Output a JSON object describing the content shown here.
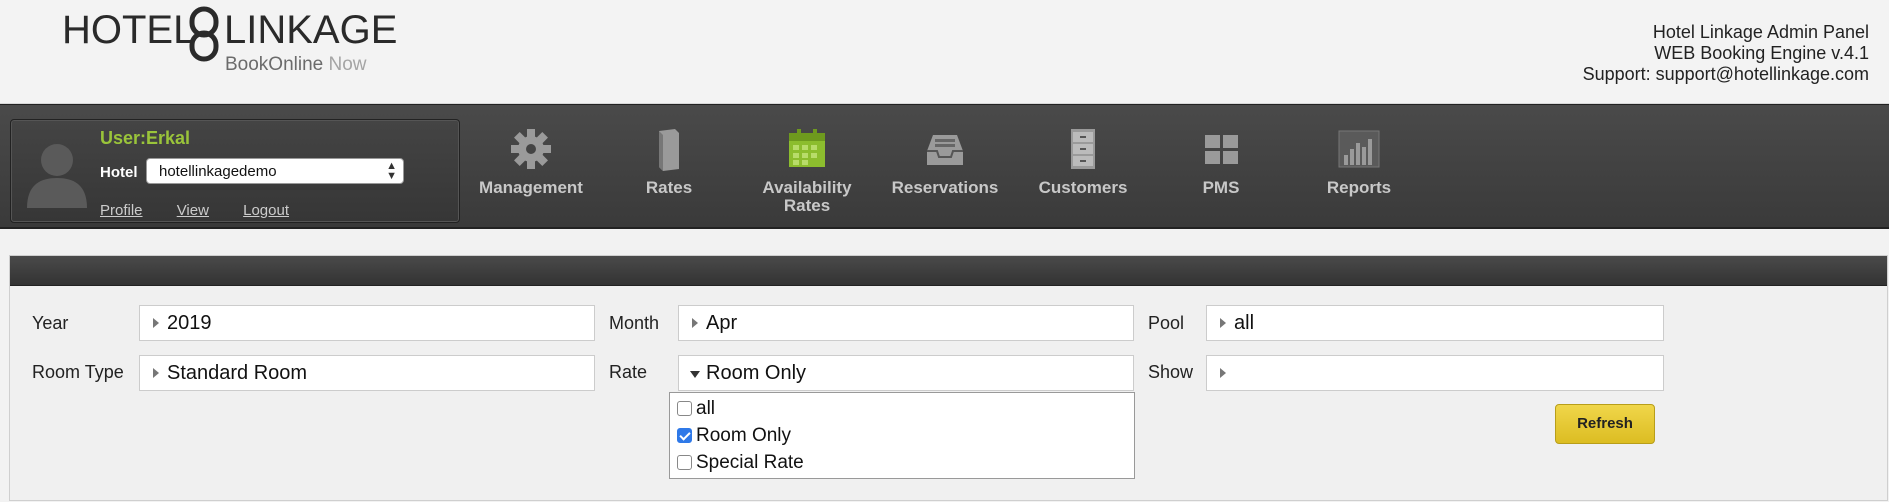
{
  "brand": {
    "word1": "HOTEL",
    "word2": "LINKAGE",
    "sub_main": "BookOnline",
    "sub_accent": "Now"
  },
  "header_info": {
    "line1": "Hotel Linkage Admin Panel",
    "line2": "WEB Booking Engine v.4.1",
    "line3": "Support: support@hotellinkage.com"
  },
  "user": {
    "name": "User:Erkal",
    "hotel_label": "Hotel",
    "hotel_value": "hotellinkagedemo",
    "links": [
      "Profile",
      "View",
      "Logout"
    ]
  },
  "nav": [
    {
      "label": "Management",
      "icon": "gear-icon"
    },
    {
      "label": "Rates",
      "icon": "book-icon"
    },
    {
      "label": "Availability Rates",
      "icon": "calendar-icon"
    },
    {
      "label": "Reservations",
      "icon": "inbox-tray-icon"
    },
    {
      "label": "Customers",
      "icon": "file-cabinet-icon"
    },
    {
      "label": "PMS",
      "icon": "grid-icon"
    },
    {
      "label": "Reports",
      "icon": "bar-chart-icon"
    }
  ],
  "filters": {
    "year_label": "Year",
    "year_value": "2019",
    "month_label": "Month",
    "month_value": "Apr",
    "pool_label": "Pool",
    "pool_value": "all",
    "roomtype_label": "Room Type",
    "roomtype_value": "Standard Room",
    "rate_label": "Rate",
    "rate_value": "Room Only",
    "show_label": "Show",
    "show_value": ""
  },
  "rate_options": [
    {
      "label": "all",
      "checked": false
    },
    {
      "label": "Room Only",
      "checked": true
    },
    {
      "label": "Special Rate",
      "checked": false
    }
  ],
  "refresh_label": "Refresh",
  "colors": {
    "accent_green": "#9ac43a",
    "refresh_yellow": "#e6c935",
    "check_blue": "#2f79e8"
  }
}
